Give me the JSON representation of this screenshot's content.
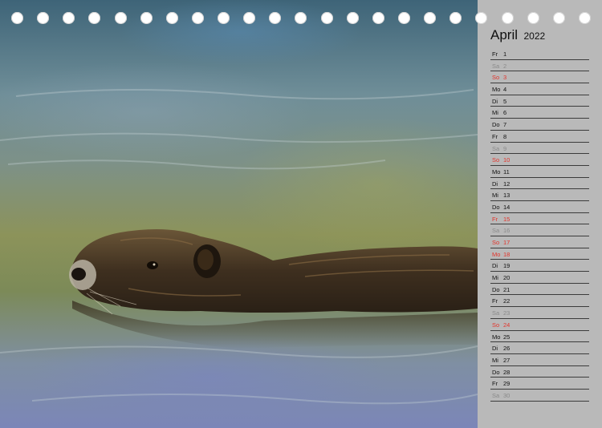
{
  "calendar": {
    "month": "April",
    "year": "2022",
    "days": [
      {
        "wd": "Fr",
        "d": "1",
        "type": "normal"
      },
      {
        "wd": "Sa",
        "d": "2",
        "type": "sat"
      },
      {
        "wd": "So",
        "d": "3",
        "type": "hol"
      },
      {
        "wd": "Mo",
        "d": "4",
        "type": "normal"
      },
      {
        "wd": "Di",
        "d": "5",
        "type": "normal"
      },
      {
        "wd": "Mi",
        "d": "6",
        "type": "normal"
      },
      {
        "wd": "Do",
        "d": "7",
        "type": "normal"
      },
      {
        "wd": "Fr",
        "d": "8",
        "type": "normal"
      },
      {
        "wd": "Sa",
        "d": "9",
        "type": "sat"
      },
      {
        "wd": "So",
        "d": "10",
        "type": "hol"
      },
      {
        "wd": "Mo",
        "d": "11",
        "type": "normal"
      },
      {
        "wd": "Di",
        "d": "12",
        "type": "normal"
      },
      {
        "wd": "Mi",
        "d": "13",
        "type": "normal"
      },
      {
        "wd": "Do",
        "d": "14",
        "type": "normal"
      },
      {
        "wd": "Fr",
        "d": "15",
        "type": "hol"
      },
      {
        "wd": "Sa",
        "d": "16",
        "type": "sat"
      },
      {
        "wd": "So",
        "d": "17",
        "type": "hol"
      },
      {
        "wd": "Mo",
        "d": "18",
        "type": "hol"
      },
      {
        "wd": "Di",
        "d": "19",
        "type": "normal"
      },
      {
        "wd": "Mi",
        "d": "20",
        "type": "normal"
      },
      {
        "wd": "Do",
        "d": "21",
        "type": "normal"
      },
      {
        "wd": "Fr",
        "d": "22",
        "type": "normal"
      },
      {
        "wd": "Sa",
        "d": "23",
        "type": "sat"
      },
      {
        "wd": "So",
        "d": "24",
        "type": "hol"
      },
      {
        "wd": "Mo",
        "d": "25",
        "type": "normal"
      },
      {
        "wd": "Di",
        "d": "26",
        "type": "normal"
      },
      {
        "wd": "Mi",
        "d": "27",
        "type": "normal"
      },
      {
        "wd": "Do",
        "d": "28",
        "type": "normal"
      },
      {
        "wd": "Fr",
        "d": "29",
        "type": "normal"
      },
      {
        "wd": "Sa",
        "d": "30",
        "type": "sat"
      }
    ]
  },
  "colors": {
    "panel": "#b9b9b9",
    "holiday": "#e3342b",
    "saturday": "#8a8a8a",
    "text": "#111111"
  },
  "binding": {
    "hole_count": 23
  }
}
